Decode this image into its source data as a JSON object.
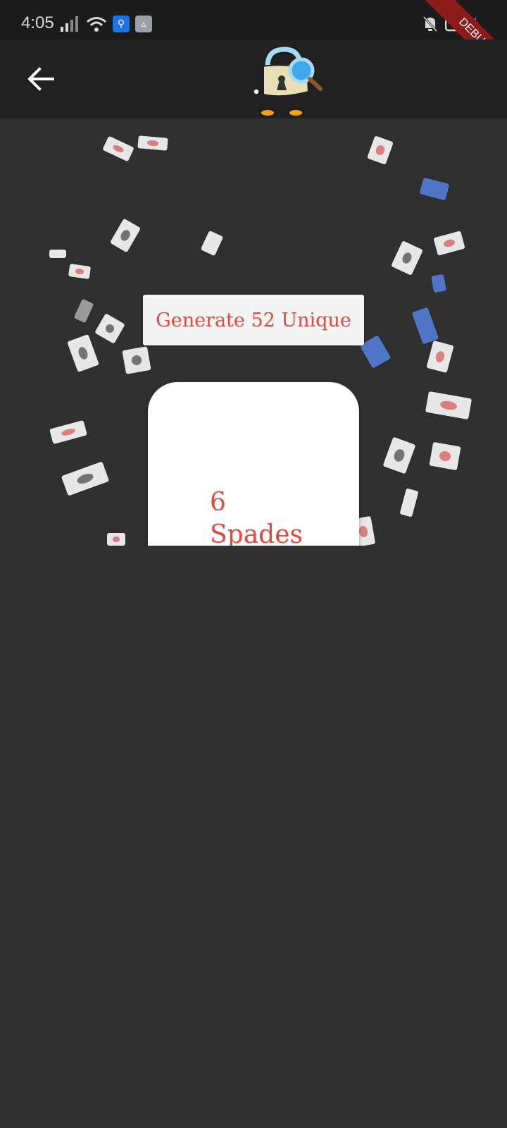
{
  "status_bar": {
    "time": "4:05",
    "icons": [
      "signal-icon",
      "wifi-icon",
      "usb-icon",
      "app-notification-icon",
      "bell-off-icon",
      "battery-charging-icon"
    ]
  },
  "debug_banner": {
    "label": "DEBUG"
  },
  "app_bar": {
    "back_icon": "arrow-left-icon",
    "logo_icon": "padlock-detective-mascot-icon"
  },
  "main": {
    "generate_button_label": "Generate 52 Unique",
    "card": {
      "rank": "6",
      "suit": "Spades"
    }
  },
  "colors": {
    "background": "#303030",
    "app_bar": "#212121",
    "status_bar": "#1c1c1c",
    "accent_red": "#e5473a",
    "card_white": "#ffffff",
    "button_bg": "#f4f4f4"
  }
}
